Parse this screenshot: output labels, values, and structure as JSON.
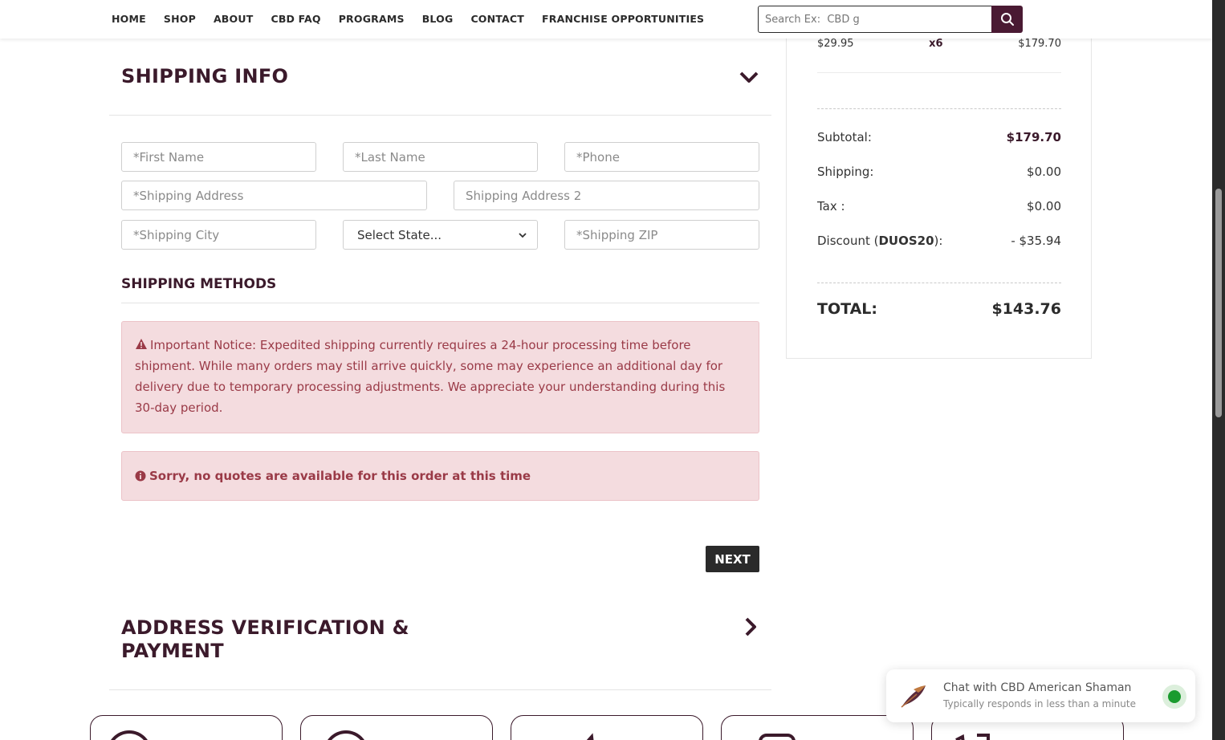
{
  "nav": {
    "items": [
      "HOME",
      "SHOP",
      "ABOUT",
      "CBD FAQ",
      "PROGRAMS",
      "BLOG",
      "CONTACT",
      "FRANCHISE OPPORTUNITIES"
    ],
    "search_placeholder": "Search Ex:  CBD g"
  },
  "shipping": {
    "title": "SHIPPING INFO",
    "first_name": "*First Name",
    "last_name": "*Last Name",
    "phone": "*Phone",
    "address": "*Shipping Address",
    "address2": "Shipping Address 2",
    "city": "*Shipping City",
    "state": "Select State...",
    "zip": "*Shipping ZIP",
    "methods_title": "SHIPPING METHODS",
    "notice": "Important Notice: Expedited shipping currently requires a 24-hour processing time before shipment. While many orders may still arrive quickly, some may experience an additional day for delivery due to temporary processing adjustments. We appreciate your understanding during this 30-day period.",
    "no_quotes": "Sorry, no quotes are available for this order at this time",
    "next_label": "NEXT"
  },
  "payment": {
    "title_line1": "ADDRESS VERIFICATION &",
    "title_line2": "PAYMENT"
  },
  "summary": {
    "item_price": "$29.95",
    "item_qty": "x6",
    "item_total": "$179.70",
    "subtotal_label": "Subtotal:",
    "subtotal_value": "$179.70",
    "shipping_label": "Shipping:",
    "shipping_value": "$0.00",
    "tax_label": "Tax :",
    "tax_value": "$0.00",
    "discount_label_prefix": "Discount (",
    "discount_code": "DUOS20",
    "discount_label_suffix": "):",
    "discount_value": "- $35.94",
    "total_label": "TOTAL:",
    "total_value": "$143.76"
  },
  "chat": {
    "title": "Chat with CBD American Shaman",
    "subtitle": "Typically responds in less than a minute"
  },
  "colors": {
    "brand": "#3b1a2b",
    "notice_bg": "#f4dcdf",
    "notice_text": "#9a3a47",
    "online": "#1a9b2e"
  }
}
